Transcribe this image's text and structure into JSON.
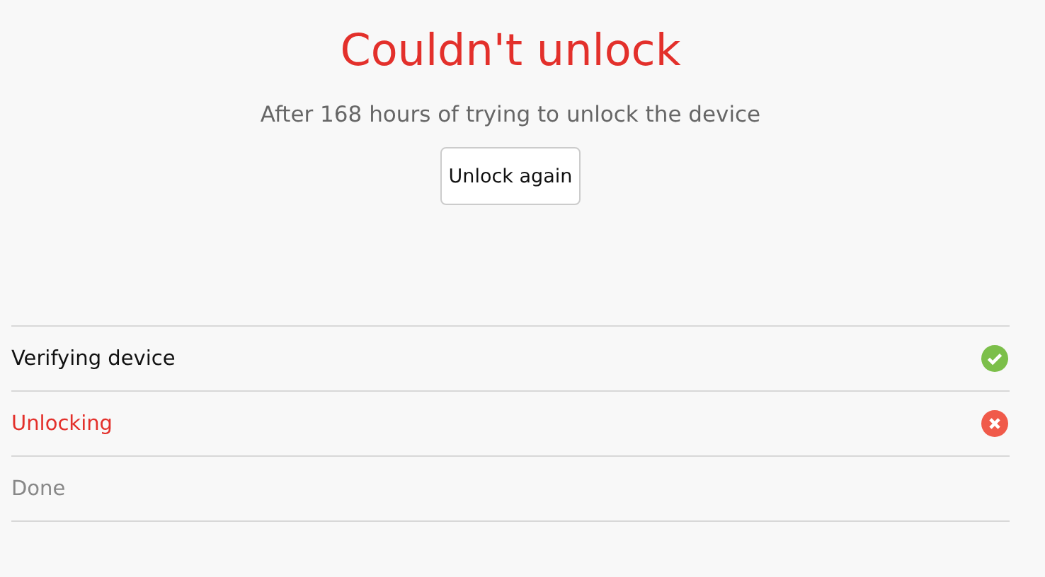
{
  "title": "Couldn't unlock",
  "message": "After 168 hours of trying to unlock the device",
  "button": "Unlock again",
  "steps": [
    {
      "label": "Verifying device",
      "kind": "done"
    },
    {
      "label": "Unlocking",
      "kind": "failed"
    },
    {
      "label": "Done",
      "kind": "pending"
    }
  ]
}
